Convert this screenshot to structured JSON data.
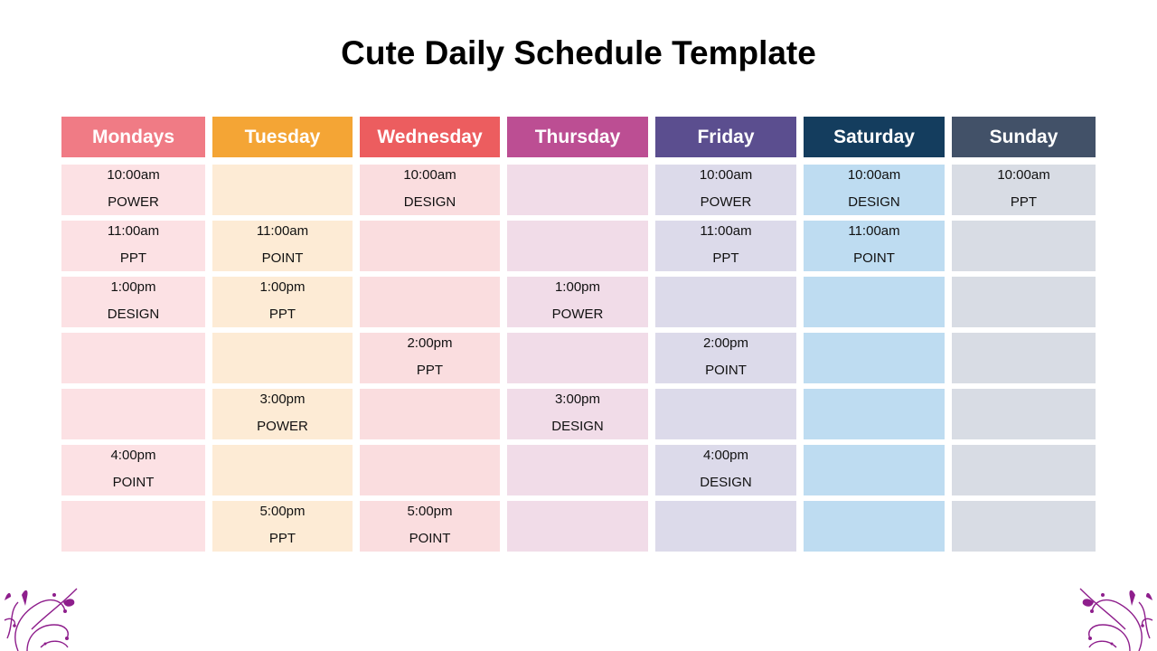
{
  "title": "Cute Daily Schedule Template",
  "days": [
    {
      "name": "Mondays",
      "header_color": "#F07B85",
      "cell_color": "#FCE1E4",
      "slots": [
        {
          "time": "10:00am",
          "label": "POWER"
        },
        {
          "time": "11:00am",
          "label": "PPT"
        },
        {
          "time": "1:00pm",
          "label": "DESIGN"
        },
        {
          "time": "",
          "label": ""
        },
        {
          "time": "",
          "label": ""
        },
        {
          "time": "4:00pm",
          "label": "POINT"
        },
        {
          "time": "",
          "label": ""
        }
      ]
    },
    {
      "name": "Tuesday",
      "header_color": "#F4A535",
      "cell_color": "#FDEBD5",
      "slots": [
        {
          "time": "",
          "label": ""
        },
        {
          "time": "11:00am",
          "label": "POINT"
        },
        {
          "time": "1:00pm",
          "label": "PPT"
        },
        {
          "time": "",
          "label": ""
        },
        {
          "time": "3:00pm",
          "label": "POWER"
        },
        {
          "time": "",
          "label": ""
        },
        {
          "time": "5:00pm",
          "label": "PPT"
        }
      ]
    },
    {
      "name": "Wednesday",
      "header_color": "#EC5D5F",
      "cell_color": "#FADDDF",
      "slots": [
        {
          "time": "10:00am",
          "label": "DESIGN"
        },
        {
          "time": "",
          "label": ""
        },
        {
          "time": "",
          "label": ""
        },
        {
          "time": "2:00pm",
          "label": "PPT"
        },
        {
          "time": "",
          "label": ""
        },
        {
          "time": "",
          "label": ""
        },
        {
          "time": "5:00pm",
          "label": "POINT"
        }
      ]
    },
    {
      "name": "Thursday",
      "header_color": "#BC4E93",
      "cell_color": "#F1DCE8",
      "slots": [
        {
          "time": "",
          "label": ""
        },
        {
          "time": "",
          "label": ""
        },
        {
          "time": "1:00pm",
          "label": "POWER"
        },
        {
          "time": "",
          "label": ""
        },
        {
          "time": "3:00pm",
          "label": "DESIGN"
        },
        {
          "time": "",
          "label": ""
        },
        {
          "time": "",
          "label": ""
        }
      ]
    },
    {
      "name": "Friday",
      "header_color": "#5B4E8F",
      "cell_color": "#DCDAEA",
      "slots": [
        {
          "time": "10:00am",
          "label": "POWER"
        },
        {
          "time": "11:00am",
          "label": "PPT"
        },
        {
          "time": "",
          "label": ""
        },
        {
          "time": "2:00pm",
          "label": "POINT"
        },
        {
          "time": "",
          "label": ""
        },
        {
          "time": "4:00pm",
          "label": "DESIGN"
        },
        {
          "time": "",
          "label": ""
        }
      ]
    },
    {
      "name": "Saturday",
      "header_color": "#143D5E",
      "cell_color": "#BEDCF1",
      "slots": [
        {
          "time": "10:00am",
          "label": "DESIGN"
        },
        {
          "time": "11:00am",
          "label": "POINT"
        },
        {
          "time": "",
          "label": ""
        },
        {
          "time": "",
          "label": ""
        },
        {
          "time": "",
          "label": ""
        },
        {
          "time": "",
          "label": ""
        },
        {
          "time": "",
          "label": ""
        }
      ]
    },
    {
      "name": "Sunday",
      "header_color": "#425168",
      "cell_color": "#D8DCE4",
      "slots": [
        {
          "time": "10:00am",
          "label": "PPT"
        },
        {
          "time": "",
          "label": ""
        },
        {
          "time": "",
          "label": ""
        },
        {
          "time": "",
          "label": ""
        },
        {
          "time": "",
          "label": ""
        },
        {
          "time": "",
          "label": ""
        },
        {
          "time": "",
          "label": ""
        }
      ]
    }
  ],
  "ornament_color": "#8E1E8C"
}
